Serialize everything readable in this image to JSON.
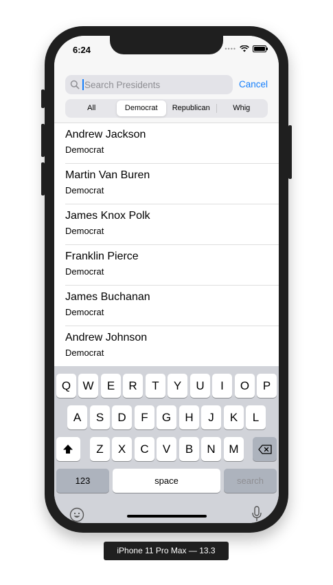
{
  "status_bar": {
    "time": "6:24"
  },
  "search": {
    "placeholder": "Search Presidents",
    "cancel_label": "Cancel"
  },
  "segments": [
    {
      "label": "All",
      "selected": false
    },
    {
      "label": "Democrat",
      "selected": true
    },
    {
      "label": "Republican",
      "selected": false
    },
    {
      "label": "Whig",
      "selected": false
    }
  ],
  "presidents": [
    {
      "name": "Andrew Jackson",
      "party": "Democrat"
    },
    {
      "name": "Martin Van Buren",
      "party": "Democrat"
    },
    {
      "name": "James Knox Polk",
      "party": "Democrat"
    },
    {
      "name": "Franklin Pierce",
      "party": "Democrat"
    },
    {
      "name": "James Buchanan",
      "party": "Democrat"
    },
    {
      "name": "Andrew Johnson",
      "party": "Democrat"
    }
  ],
  "keyboard": {
    "row1": [
      "Q",
      "W",
      "E",
      "R",
      "T",
      "Y",
      "U",
      "I",
      "O",
      "P"
    ],
    "row2": [
      "A",
      "S",
      "D",
      "F",
      "G",
      "H",
      "J",
      "K",
      "L"
    ],
    "row3": [
      "Z",
      "X",
      "C",
      "V",
      "B",
      "N",
      "M"
    ],
    "numbers_label": "123",
    "space_label": "space",
    "search_label": "search"
  },
  "device_label": "iPhone 11 Pro Max — 13.3"
}
